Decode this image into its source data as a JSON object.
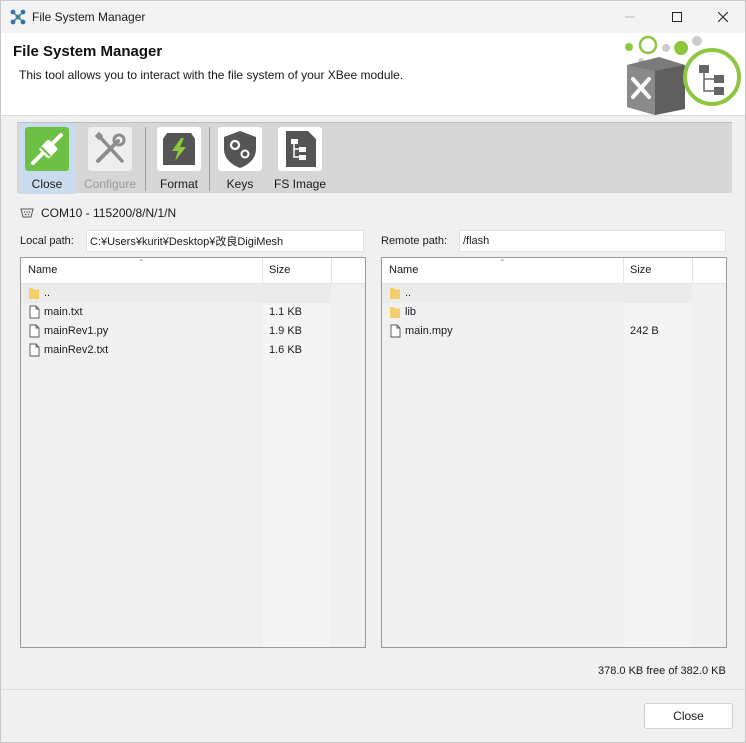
{
  "window": {
    "title": "File System Manager"
  },
  "header": {
    "title": "File System Manager",
    "description": "This tool allows you to interact with the file system of your XBee module."
  },
  "toolbar": {
    "buttons": [
      {
        "label": "Close",
        "icon": "plug-connected-icon",
        "state": "selected",
        "color": "#6dbf45"
      },
      {
        "label": "Configure",
        "icon": "wrench-screwdriver-icon",
        "state": "disabled",
        "color": "#8c8c8c"
      },
      {
        "label": "Format",
        "icon": "format-chip-icon",
        "state": "enabled",
        "color": "#555555"
      },
      {
        "label": "Keys",
        "icon": "shield-gears-icon",
        "state": "enabled",
        "color": "#555555"
      },
      {
        "label": "FS Image",
        "icon": "filesystem-image-icon",
        "state": "enabled",
        "color": "#555555"
      }
    ]
  },
  "connection": {
    "text": "COM10 - 115200/8/N/1/N"
  },
  "local": {
    "path_label": "Local path:",
    "path_value": "C:¥Users¥kurit¥Desktop¥改良DigiMesh",
    "columns": {
      "name": "Name",
      "size": "Size"
    },
    "files": [
      {
        "name": "..",
        "size": "",
        "type": "folder"
      },
      {
        "name": "main.txt",
        "size": "1.1 KB",
        "type": "file"
      },
      {
        "name": "mainRev1.py",
        "size": "1.9 KB",
        "type": "file"
      },
      {
        "name": "mainRev2.txt",
        "size": "1.6 KB",
        "type": "file"
      }
    ]
  },
  "remote": {
    "path_label": "Remote path:",
    "path_value": "/flash",
    "columns": {
      "name": "Name",
      "size": "Size"
    },
    "files": [
      {
        "name": "..",
        "size": "",
        "type": "folder"
      },
      {
        "name": "lib",
        "size": "",
        "type": "folder"
      },
      {
        "name": "main.mpy",
        "size": "242 B",
        "type": "file"
      }
    ]
  },
  "status": {
    "free_space": "378.0 KB free of 382.0 KB"
  },
  "footer": {
    "close_label": "Close"
  },
  "colors": {
    "accent_green": "#6dbf45",
    "folder_yellow": "#f4d06b",
    "toolbar_bg": "#d6d6d6"
  }
}
